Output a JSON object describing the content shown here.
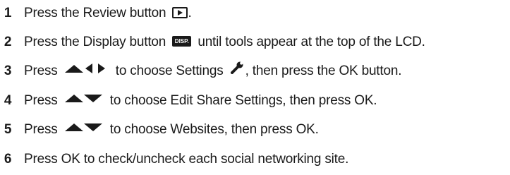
{
  "steps": [
    {
      "number": "1",
      "before": "Press the Review button",
      "after": ".",
      "icon": "review-play-icon"
    },
    {
      "number": "2",
      "before": "Press the Display button",
      "icon_label": "DISP.",
      "after": "until tools appear at the top of the LCD.",
      "icon": "display-button-icon"
    },
    {
      "number": "3",
      "before": "Press",
      "middle": "to choose Settings",
      "after": ", then press the OK button.",
      "icons": [
        "up-arrow-icon",
        "left-arrow-icon",
        "right-arrow-icon",
        "wrench-icon"
      ]
    },
    {
      "number": "4",
      "before": "Press",
      "after": "to choose Edit Share Settings, then press OK.",
      "icons": [
        "up-arrow-icon",
        "down-arrow-icon"
      ]
    },
    {
      "number": "5",
      "before": "Press",
      "after": "to choose Websites, then press OK.",
      "icons": [
        "up-arrow-icon",
        "down-arrow-icon"
      ]
    },
    {
      "number": "6",
      "text": "Press OK to check/uncheck each social networking site."
    }
  ],
  "colors": {
    "text": "#1a1a1a",
    "background": "#ffffff"
  }
}
